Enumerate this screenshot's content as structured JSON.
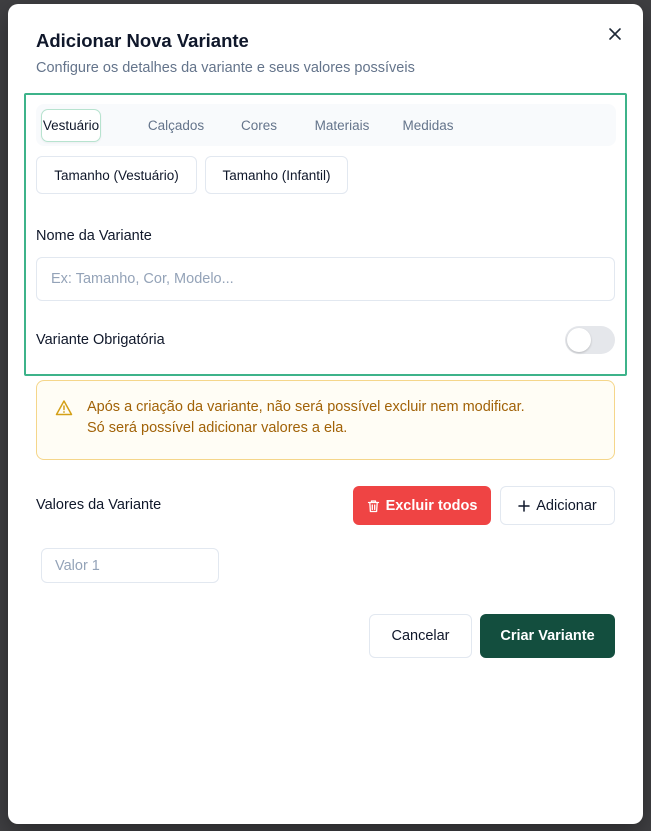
{
  "dialog": {
    "title": "Adicionar Nova Variante",
    "subtitle": "Configure os detalhes da variante e seus valores possíveis",
    "close_icon": "close-icon"
  },
  "tabs": [
    {
      "label": "Vestuário",
      "active": true
    },
    {
      "label": "Calçados",
      "active": false
    },
    {
      "label": "Cores",
      "active": false
    },
    {
      "label": "Materiais",
      "active": false
    },
    {
      "label": "Medidas",
      "active": false
    }
  ],
  "presets": [
    {
      "label": "Tamanho (Vestuário)"
    },
    {
      "label": "Tamanho (Infantil)"
    }
  ],
  "name_field": {
    "label": "Nome da Variante",
    "placeholder": "Ex: Tamanho, Cor, Modelo...",
    "value": ""
  },
  "required_toggle": {
    "label": "Variante Obrigatória",
    "checked": false
  },
  "warning": {
    "icon": "warning-triangle-icon",
    "line1": "Após a criação da variante, não será possível excluir nem modificar.",
    "line2": "Só será possível adicionar valores a ela."
  },
  "values_section": {
    "label": "Valores da Variante",
    "delete_all_label": "Excluir todos",
    "delete_icon": "trash-icon",
    "add_label": "Adicionar",
    "add_icon": "plus-icon",
    "value_inputs": [
      {
        "placeholder": "Valor 1",
        "value": ""
      }
    ]
  },
  "footer": {
    "cancel_label": "Cancelar",
    "create_label": "Criar Variante"
  },
  "colors": {
    "accent_green": "#134e3e",
    "danger_red": "#ef4444",
    "warning_text": "#a16207",
    "highlight_border": "#3db38a"
  }
}
